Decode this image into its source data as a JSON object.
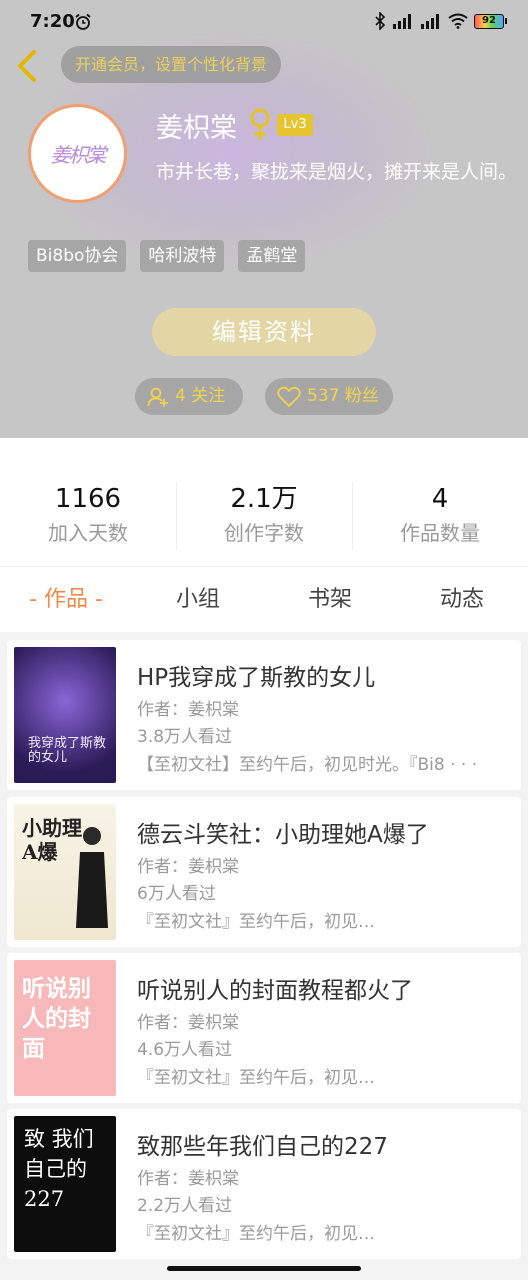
{
  "status_bar": {
    "time": "7:20",
    "battery": "92"
  },
  "header": {
    "vip_banner": "开通会员，设置个性化背景",
    "avatar_text": "姜枳棠",
    "username": "姜枳棠",
    "level": "Lv3",
    "bio": "市井长巷，聚拢来是烟火，摊开来是人间。",
    "tags": [
      "Bi8bo协会",
      "哈利波特",
      "孟鹤堂"
    ],
    "edit_button": "编辑资料",
    "follow_label": "4 关注",
    "fans_label": "537 粉丝"
  },
  "stats": [
    {
      "value": "1166",
      "label": "加入天数"
    },
    {
      "value": "2.1万",
      "label": "创作字数"
    },
    {
      "value": "4",
      "label": "作品数量"
    }
  ],
  "tabs": [
    "- 作品 -",
    "小组",
    "书架",
    "动态"
  ],
  "books": [
    {
      "title": "HP我穿成了斯教的女儿",
      "author": "作者：姜枳棠",
      "views": "3.8万人看过",
      "desc": "【至初文社】至约午后，初见时光。『Bi8 · · ·",
      "cover_text": "我穿成了斯教的女儿"
    },
    {
      "title": "德云斗笑社：小助理她A爆了",
      "author": "作者：姜枳棠",
      "views": "6万人看过",
      "desc": "『至初文社』至约午后，初见…",
      "cover_text": "小助理 A爆"
    },
    {
      "title": "听说别人的封面教程都火了",
      "author": "作者：姜枳棠",
      "views": "4.6万人看过",
      "desc": "『至初文社』至约午后，初见…",
      "cover_text": "听说别人的封面"
    },
    {
      "title": "致那些年我们自己的227",
      "author": "作者：姜枳棠",
      "views": "2.2万人看过",
      "desc": "『至初文社』至约午后，初见…",
      "cover_text": "致 我们 自己的 227"
    }
  ],
  "colors": {
    "accent": "#f08a4a",
    "gold": "#f2d34a",
    "level_badge": "#e5c430",
    "edit_button": "#e4d6a4"
  }
}
